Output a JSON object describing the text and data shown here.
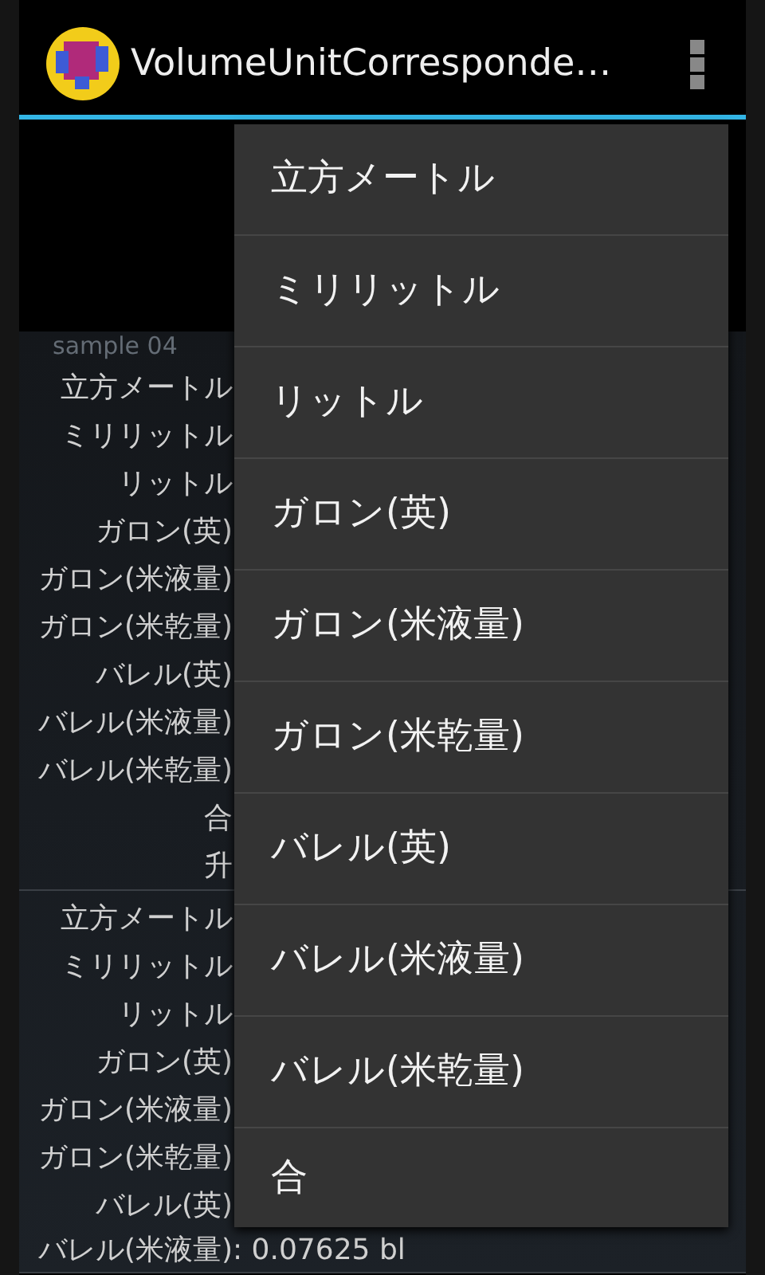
{
  "action_bar": {
    "title": "VolumeUnitCorresponde…"
  },
  "content": {
    "caption": "sample 04",
    "groups": [
      {
        "rows": [
          {
            "label": "立方メートル"
          },
          {
            "label": "ミリリットル"
          },
          {
            "label": "リットル"
          },
          {
            "label": "ガロン(英)"
          },
          {
            "label": "ガロン(米液量)"
          },
          {
            "label": "ガロン(米乾量)"
          },
          {
            "label": "バレル(英)"
          },
          {
            "label": "バレル(米液量)"
          },
          {
            "label": "バレル(米乾量)"
          },
          {
            "label": "合"
          },
          {
            "label": "升"
          }
        ]
      },
      {
        "rows": [
          {
            "label": "立方メートル"
          },
          {
            "label": "ミリリットル"
          },
          {
            "label": "リットル"
          },
          {
            "label": "ガロン(英)"
          },
          {
            "label": "ガロン(米液量)"
          },
          {
            "label": "ガロン(米乾量)"
          },
          {
            "label": "バレル(英)"
          },
          {
            "label": "バレル(米液量)",
            "value": ": 0.07625 bl"
          }
        ]
      }
    ]
  },
  "menu": {
    "items": [
      {
        "label": "立方メートル"
      },
      {
        "label": "ミリリットル"
      },
      {
        "label": "リットル"
      },
      {
        "label": "ガロン(英)"
      },
      {
        "label": "ガロン(米液量)"
      },
      {
        "label": "ガロン(米乾量)"
      },
      {
        "label": "バレル(英)"
      },
      {
        "label": "バレル(米液量)"
      },
      {
        "label": "バレル(米乾量)"
      },
      {
        "label": "合"
      }
    ]
  }
}
